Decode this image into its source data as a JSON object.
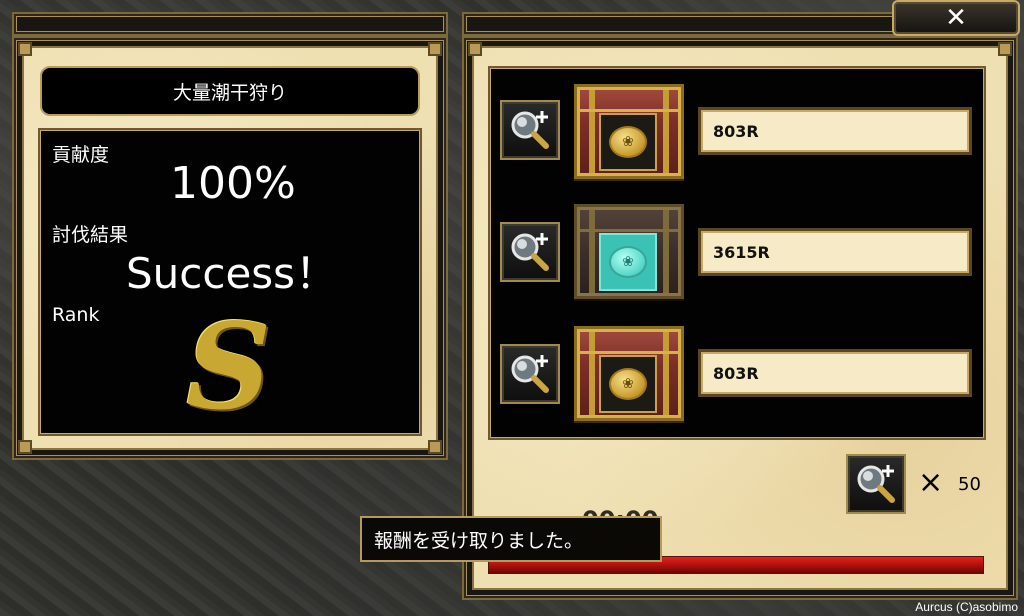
{
  "left_panel": {
    "title": "大量潮干狩り",
    "contribution_label": "貢献度",
    "contribution_value": "100%",
    "result_label": "討伐結果",
    "result_value": "Success！",
    "rank_label": "Rank",
    "rank_value": "S"
  },
  "close_button": {
    "label": "✕"
  },
  "rewards": [
    {
      "amount": "803R",
      "chest_style": "red",
      "coin_style": "gold"
    },
    {
      "amount": "3615R",
      "chest_style": "dark",
      "coin_style": "teal"
    },
    {
      "amount": "803R",
      "chest_style": "red",
      "coin_style": "gold"
    }
  ],
  "magnifier_item": {
    "multiplier": "×",
    "count": "50"
  },
  "toast": {
    "message": "報酬を受け取りました。"
  },
  "timer_text": "00:00",
  "time_bar": {
    "fill_fraction": 1.0
  },
  "copyright": "Aurcus (C)asobimo",
  "colors": {
    "frame_gold": "#b79c5e",
    "parchment": "#efe0b2",
    "timer_red": "#c4150f"
  }
}
